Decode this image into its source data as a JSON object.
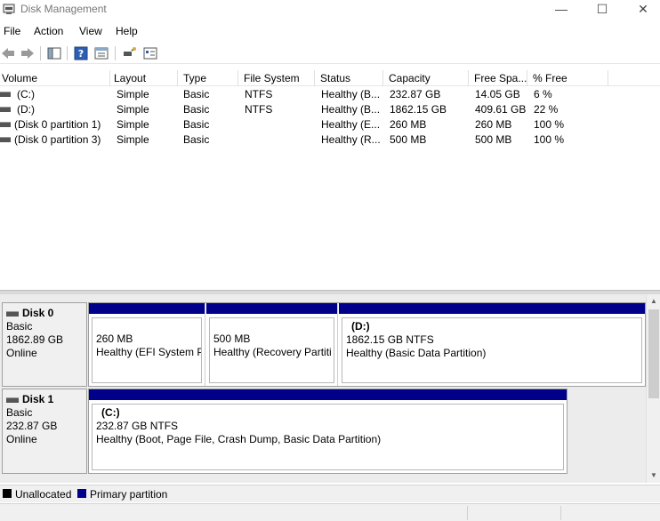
{
  "window": {
    "title": "Disk Management",
    "minimize": "—",
    "maximize": "☐",
    "close": "✕"
  },
  "menu": [
    "File",
    "Action",
    "View",
    "Help"
  ],
  "toolbar": [
    "back-icon",
    "forward-icon",
    "console-tree-icon",
    "help-icon",
    "properties-icon",
    "connect-icon",
    "checklist-icon"
  ],
  "volumes": {
    "columns": [
      "Volume",
      "Layout",
      "Type",
      "File System",
      "Status",
      "Capacity",
      "Free Spa...",
      "% Free"
    ],
    "rows": [
      [
        "(C:)",
        "Simple",
        "Basic",
        "NTFS",
        "Healthy (B...",
        "232.87 GB",
        "14.05 GB",
        "6 %"
      ],
      [
        "(D:)",
        "Simple",
        "Basic",
        "NTFS",
        "Healthy (B...",
        "1862.15 GB",
        "409.61 GB",
        "22 %"
      ],
      [
        "(Disk 0 partition 1)",
        "Simple",
        "Basic",
        "",
        "Healthy (E...",
        "260 MB",
        "260 MB",
        "100 %"
      ],
      [
        "(Disk 0 partition 3)",
        "Simple",
        "Basic",
        "",
        "Healthy (R...",
        "500 MB",
        "500 MB",
        "100 %"
      ]
    ]
  },
  "disks": [
    {
      "name": "Disk 0",
      "type": "Basic",
      "size": "1862.89 GB",
      "state": "Online",
      "partitions": [
        {
          "label": "",
          "size": "260 MB",
          "status": "Healthy (EFI System Pa"
        },
        {
          "label": "",
          "size": "500 MB",
          "status": "Healthy (Recovery Partiti"
        },
        {
          "label": "(D:)",
          "size": "1862.15 GB NTFS",
          "status": "Healthy (Basic Data Partition)"
        }
      ]
    },
    {
      "name": "Disk 1",
      "type": "Basic",
      "size": "232.87 GB",
      "state": "Online",
      "partitions": [
        {
          "label": "(C:)",
          "size": "232.87 GB NTFS",
          "status": "Healthy (Boot, Page File, Crash Dump, Basic Data Partition)"
        }
      ]
    }
  ],
  "legend": {
    "unallocated": "Unallocated",
    "unallocated_color": "#000000",
    "primary": "Primary partition",
    "primary_color": "#00008b"
  }
}
